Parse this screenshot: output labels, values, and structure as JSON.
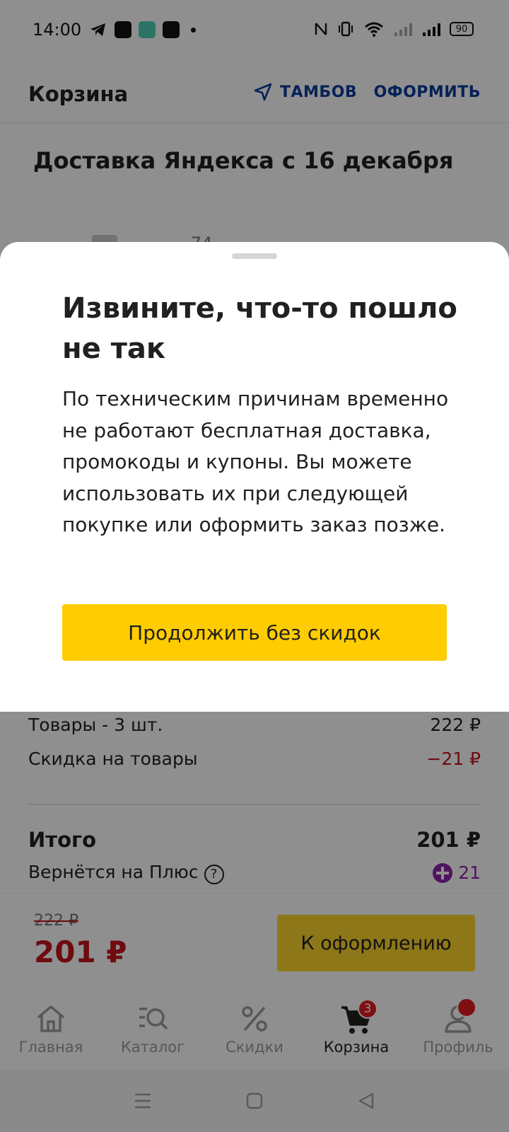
{
  "status_bar": {
    "time": "14:00",
    "battery": "90"
  },
  "header": {
    "title": "Корзина",
    "location": "ТАМБОВ",
    "checkout_link": "ОФОРМИТЬ"
  },
  "delivery": {
    "title": "Доставка Яндекса с 16 декабря",
    "partial_price": "74"
  },
  "summary": {
    "items_label": "Товары - 3 шт.",
    "items_value": "222 ₽",
    "discount_label": "Скидка на товары",
    "discount_value": "−21 ₽",
    "total_label": "Итого",
    "total_value": "201 ₽",
    "plus_label": "Вернётся на Плюс",
    "plus_value": "21"
  },
  "checkout_bar": {
    "old_price": "222 ₽",
    "new_price": "201 ₽",
    "button": "К оформлению"
  },
  "tabs": [
    {
      "label": "Главная",
      "icon": "home-icon"
    },
    {
      "label": "Каталог",
      "icon": "catalog-search-icon"
    },
    {
      "label": "Скидки",
      "icon": "percent-icon"
    },
    {
      "label": "Корзина",
      "icon": "cart-icon",
      "badge": "3",
      "active": true
    },
    {
      "label": "Профиль",
      "icon": "profile-icon"
    }
  ],
  "sheet": {
    "title": "Извините, что-то пошло не так",
    "text": "По техническим причинам временно не работают бесплатная доставка, промокоды и купоны. Вы можете использовать их при следующей покупке или оформить заказ позже.",
    "button": "Продолжить без скидок"
  },
  "colors": {
    "accent_yellow": "#fecc00",
    "link_blue": "#0a3c9c",
    "discount_red": "#c4151c",
    "plus_purple": "#8e24aa"
  }
}
